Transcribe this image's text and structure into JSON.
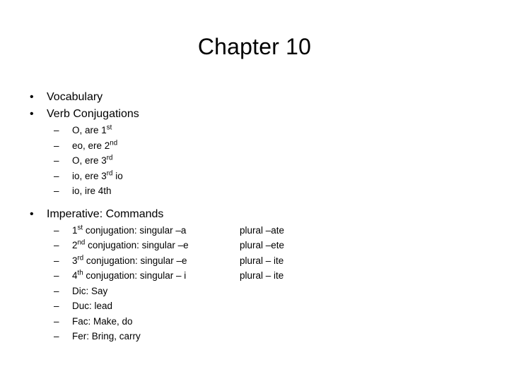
{
  "slide": {
    "title": "Chapter 10",
    "bullet_marker": "•",
    "dash_marker": "–",
    "sections": [
      {
        "label": "Vocabulary",
        "children": []
      },
      {
        "label": "Verb Conjugations",
        "children": [
          {
            "main_pre": "O, are 1",
            "main_sup": "st",
            "main_post": "",
            "right": ""
          },
          {
            "main_pre": "eo, ere 2",
            "main_sup": "nd",
            "main_post": "",
            "right": ""
          },
          {
            "main_pre": "O, ere 3",
            "main_sup": "rd",
            "main_post": "",
            "right": ""
          },
          {
            "main_pre": "io, ere 3",
            "main_sup": "rd",
            "main_post": " io",
            "right": ""
          },
          {
            "main_pre": "io, ire 4th",
            "main_sup": "",
            "main_post": "",
            "right": ""
          }
        ]
      },
      {
        "label": "Imperative: Commands",
        "children": [
          {
            "main_pre": "1",
            "main_sup": "st",
            "main_post": " conjugation: singular –a",
            "right": "plural –ate"
          },
          {
            "main_pre": "2",
            "main_sup": "nd",
            "main_post": " conjugation: singular –e",
            "right": "plural –ete"
          },
          {
            "main_pre": "3",
            "main_sup": "rd",
            "main_post": " conjugation: singular –e",
            "right": "plural – ite"
          },
          {
            "main_pre": "4",
            "main_sup": "th",
            "main_post": " conjugation: singular – i",
            "right": "plural – ite"
          },
          {
            "main_pre": "Dic: Say",
            "main_sup": "",
            "main_post": "",
            "right": ""
          },
          {
            "main_pre": "Duc: lead",
            "main_sup": "",
            "main_post": "",
            "right": ""
          },
          {
            "main_pre": "Fac: Make, do",
            "main_sup": "",
            "main_post": "",
            "right": ""
          },
          {
            "main_pre": "Fer: Bring, carry",
            "main_sup": "",
            "main_post": "",
            "right": ""
          }
        ]
      }
    ]
  }
}
